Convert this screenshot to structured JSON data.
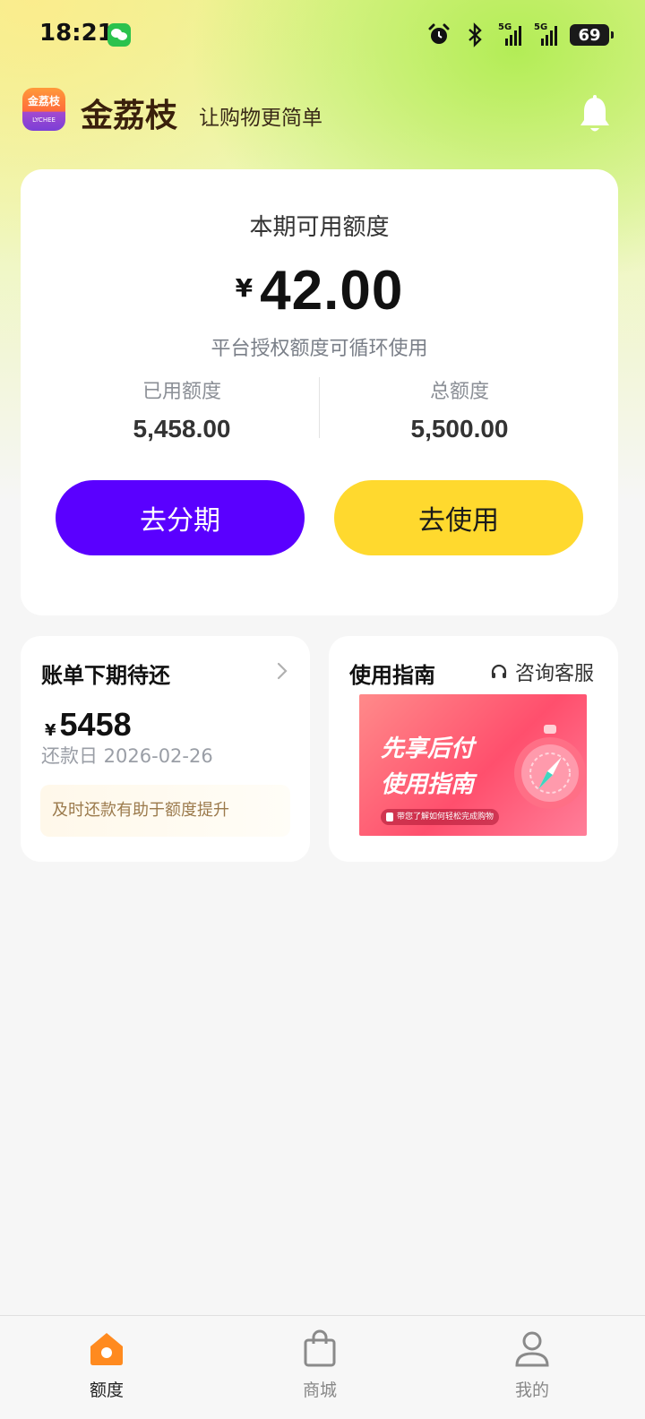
{
  "status_bar": {
    "time": "18:21",
    "network_1": "5G",
    "network_2": "5G",
    "battery": "69"
  },
  "header": {
    "app_logo_text": "金荔枝",
    "app_logo_sub": "LYCHEE",
    "app_name": "金荔枝",
    "slogan": "让购物更简单",
    "icons": {
      "notification": "bell-icon"
    }
  },
  "credit": {
    "title": "本期可用额度",
    "currency": "¥",
    "available": "42.00",
    "note": "平台授权额度可循环使用",
    "used_label": "已用额度",
    "used_value": "5,458.00",
    "total_label": "总额度",
    "total_value": "5,500.00",
    "installment_button": "去分期",
    "use_button": "去使用"
  },
  "bill": {
    "title": "账单下期待还",
    "currency": "¥",
    "amount": "5458",
    "due_date": "还款日 2026-02-26",
    "tip": "及时还款有助于额度提升"
  },
  "guide": {
    "title": "使用指南",
    "support_label": "咨询客服",
    "banner_line1": "先享后付",
    "banner_line2": "使用指南",
    "banner_sub": "带您了解如何轻松完成购物"
  },
  "tab_bar": {
    "items": [
      {
        "label": "额度",
        "icon": "home-icon",
        "active": true
      },
      {
        "label": "商城",
        "icon": "shopping-bag-icon",
        "active": false
      },
      {
        "label": "我的",
        "icon": "user-icon",
        "active": false
      }
    ]
  },
  "colors": {
    "primary_purple": "#5a00ff",
    "accent_yellow": "#ffd92e",
    "home_icon_orange": "#ff8a1f"
  }
}
